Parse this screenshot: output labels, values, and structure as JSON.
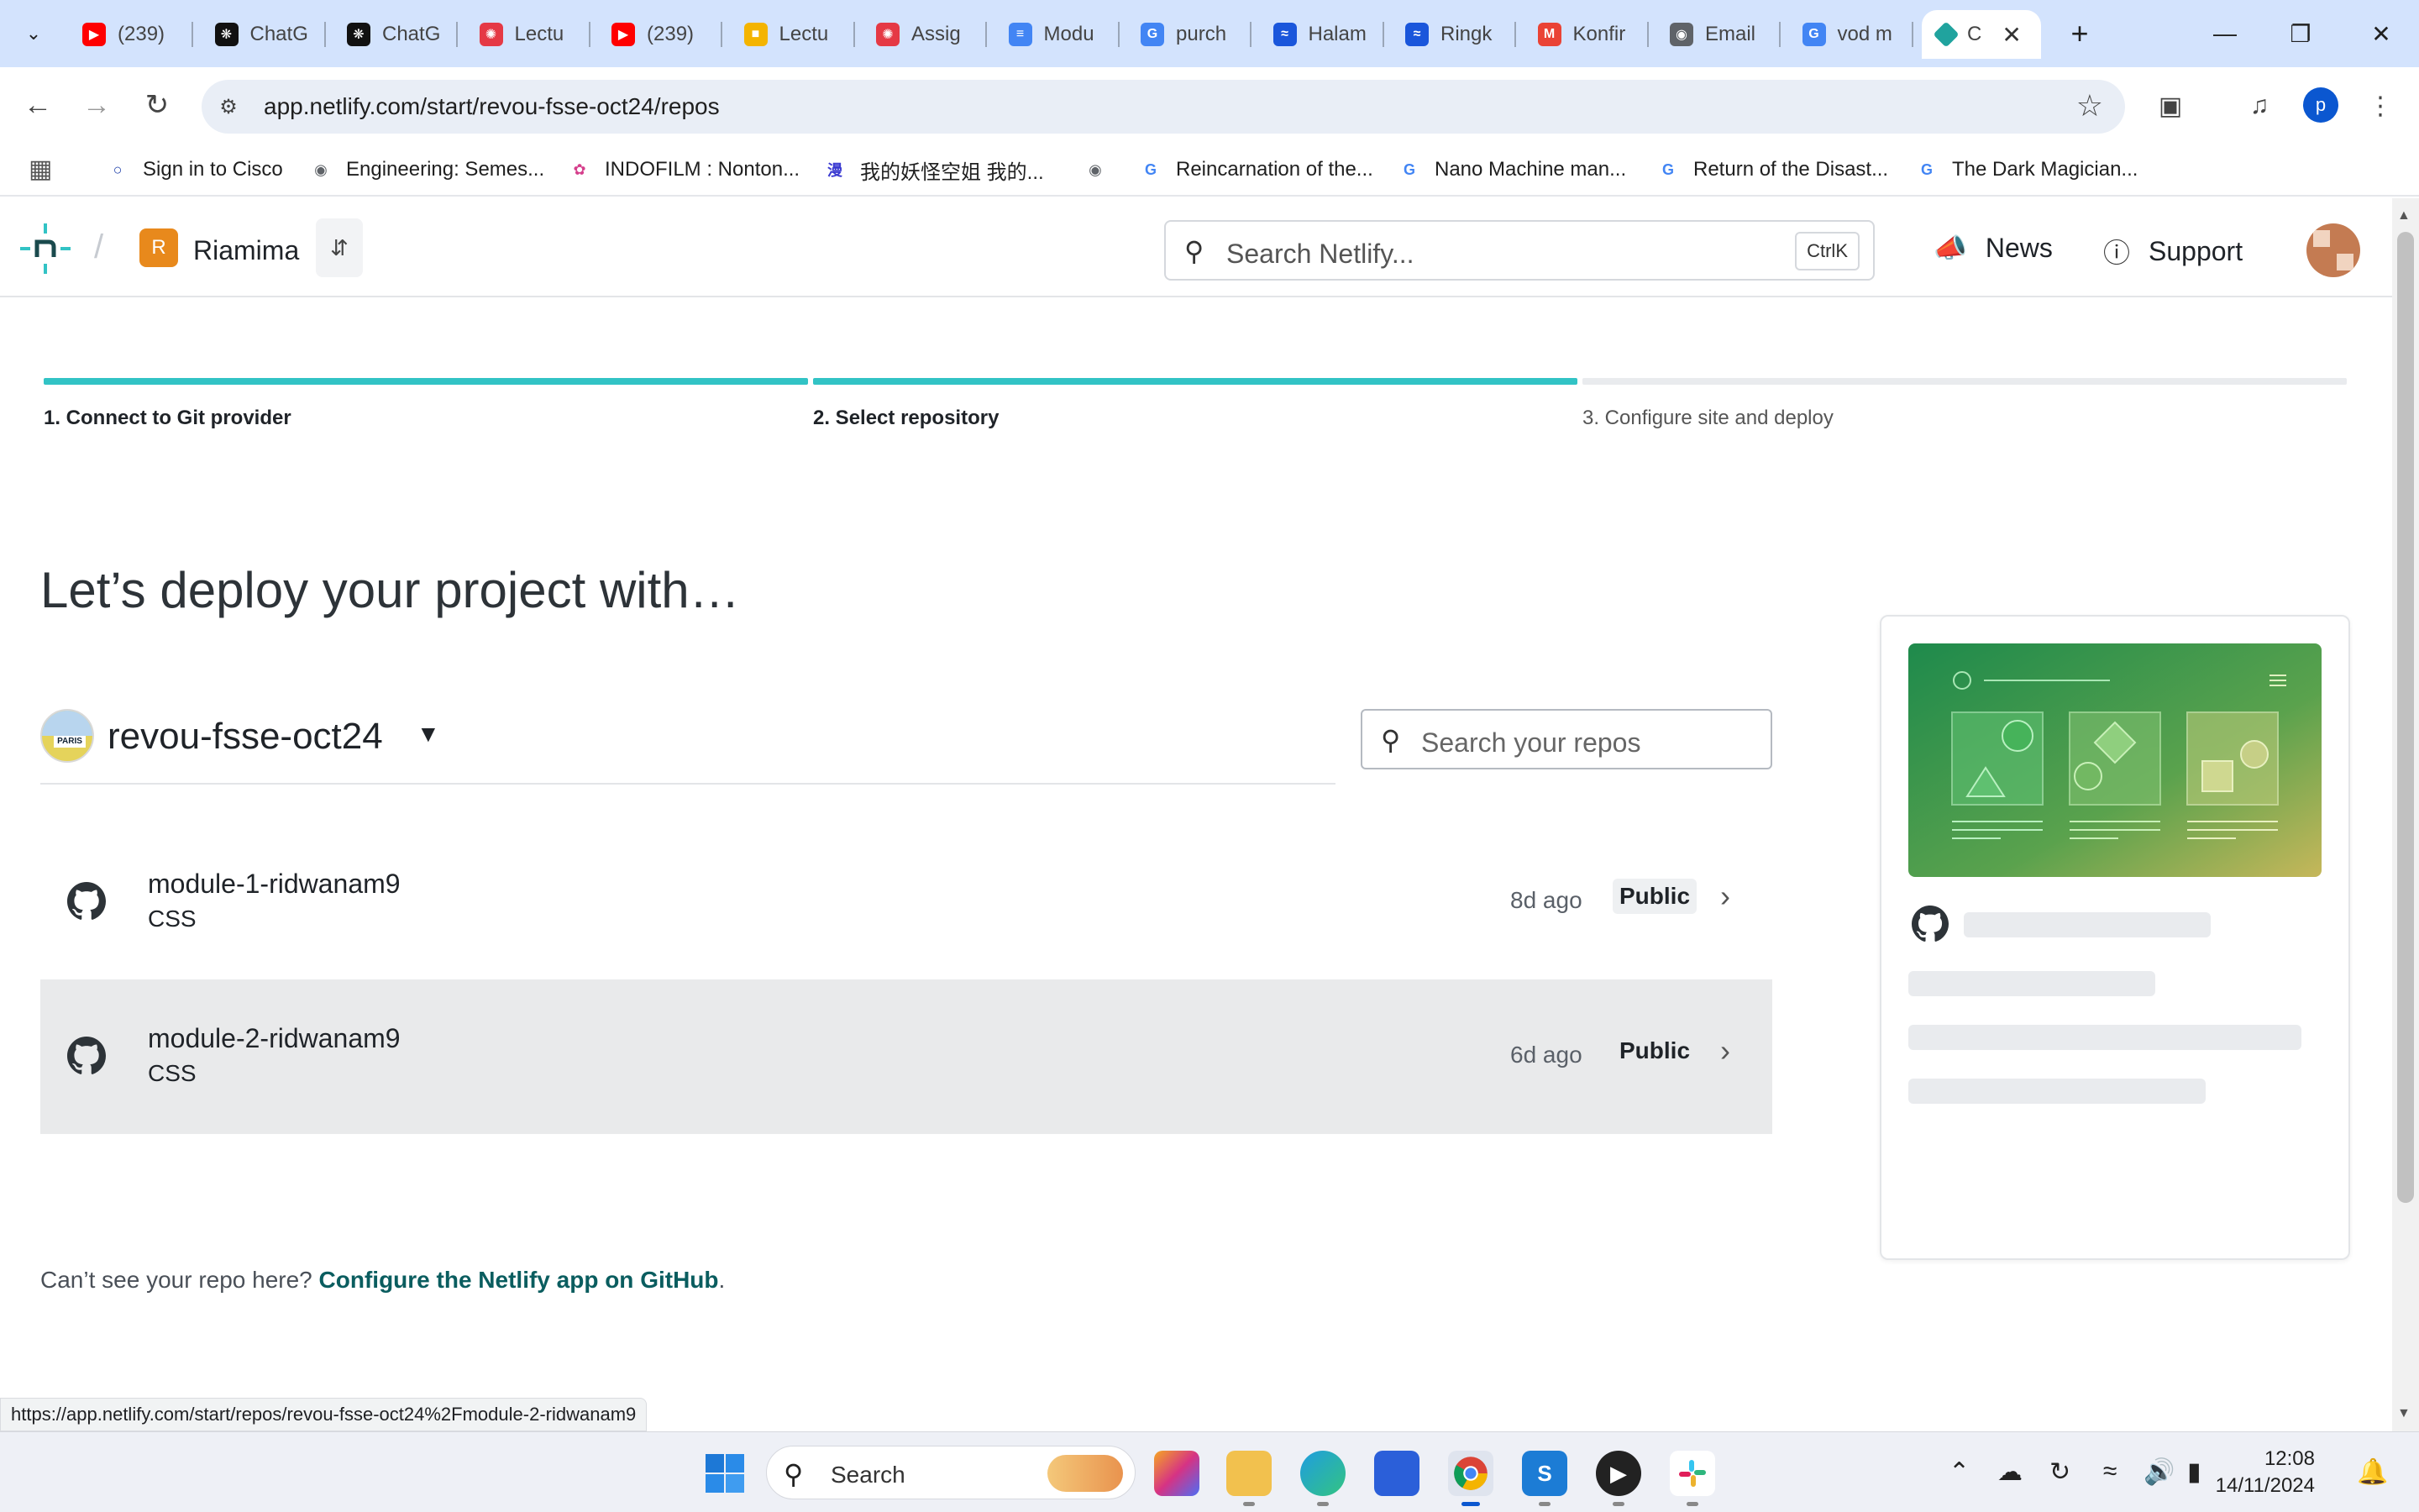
{
  "browser": {
    "tabs": [
      {
        "title": "(239)",
        "icon": "youtube-icon",
        "color": "#ff0000"
      },
      {
        "title": "ChatG",
        "icon": "chatgpt-icon",
        "color": "#111111"
      },
      {
        "title": "ChatG",
        "icon": "chatgpt-icon",
        "color": "#111111"
      },
      {
        "title": "Lectu",
        "icon": "revou-icon",
        "color": "#e53945"
      },
      {
        "title": "(239)",
        "icon": "youtube-icon",
        "color": "#ff0000"
      },
      {
        "title": "Lectu",
        "icon": "slides-icon",
        "color": "#f4b400"
      },
      {
        "title": "Assig",
        "icon": "revou-icon",
        "color": "#e53945"
      },
      {
        "title": "Modu",
        "icon": "docs-icon",
        "color": "#4285f4"
      },
      {
        "title": "purch",
        "icon": "google-icon",
        "color": "#4285f4"
      },
      {
        "title": "Halam",
        "icon": "halaman-icon",
        "color": "#1a56db"
      },
      {
        "title": "Ringk",
        "icon": "halaman-icon",
        "color": "#1a56db"
      },
      {
        "title": "Konfir",
        "icon": "gmail-icon",
        "color": "#ea4335"
      },
      {
        "title": "Email",
        "icon": "globe-icon",
        "color": "#5f6368"
      },
      {
        "title": "vod m",
        "icon": "google-icon",
        "color": "#4285f4"
      }
    ],
    "active_tab": {
      "title": "C",
      "icon": "netlify-icon",
      "color": "#20a39e"
    },
    "url": "app.netlify.com/start/revou-fsse-oct24/repos",
    "profile_initial": "p",
    "bookmarks": [
      {
        "label": "Sign in to Cisco",
        "icon": "cisco-icon",
        "color": "#1d3faa"
      },
      {
        "label": "Engineering: Semes...",
        "icon": "globe-icon",
        "color": "#5f6368"
      },
      {
        "label": "INDOFILM : Nonton...",
        "icon": "indofilm-icon",
        "color": "#d53f8c"
      },
      {
        "label": "我的妖怪空姐 我的...",
        "icon": "manhua-icon",
        "color": "#3b3bd1"
      },
      {
        "label": "",
        "icon": "globe-icon",
        "color": "#5f6368"
      },
      {
        "label": "Reincarnation of the...",
        "icon": "google-icon",
        "color": "#4285f4"
      },
      {
        "label": "Nano Machine man...",
        "icon": "google-icon",
        "color": "#4285f4"
      },
      {
        "label": "Return of the Disast...",
        "icon": "google-icon",
        "color": "#4285f4"
      },
      {
        "label": "The Dark Magician...",
        "icon": "google-icon",
        "color": "#4285f4"
      }
    ],
    "status_url": "https://app.netlify.com/start/repos/revou-fsse-oct24%2Fmodule-2-ridwanam9"
  },
  "netlify": {
    "team_initial": "R",
    "team_name": "Riamima",
    "search_placeholder": "Search Netlify...",
    "search_shortcut": "CtrlK",
    "news_label": "News",
    "support_label": "Support",
    "steps": [
      {
        "label": "1. Connect to Git provider",
        "state": "done"
      },
      {
        "label": "2. Select repository",
        "state": "done"
      },
      {
        "label": "3. Configure site and deploy",
        "state": "pending"
      }
    ],
    "heading": "Let’s deploy your project with…",
    "org_name": "revou-fsse-oct24",
    "org_avatar_text": "PARIS",
    "repo_search_placeholder": "Search your repos",
    "repos": [
      {
        "name": "module-1-ridwanam9",
        "language": "CSS",
        "updated": "8d ago",
        "visibility": "Public"
      },
      {
        "name": "module-2-ridwanam9",
        "language": "CSS",
        "updated": "6d ago",
        "visibility": "Public"
      }
    ],
    "footer_text": "Can’t see your repo here?",
    "footer_link": "Configure the Netlify app on GitHub",
    "footer_end": "."
  },
  "taskbar": {
    "search_label": "Search",
    "time": "12:08",
    "date": "14/11/2024"
  },
  "colors": {
    "accent_teal": "#32c3c5",
    "link_green": "#0a5d5f",
    "team_orange": "#e8891c"
  }
}
